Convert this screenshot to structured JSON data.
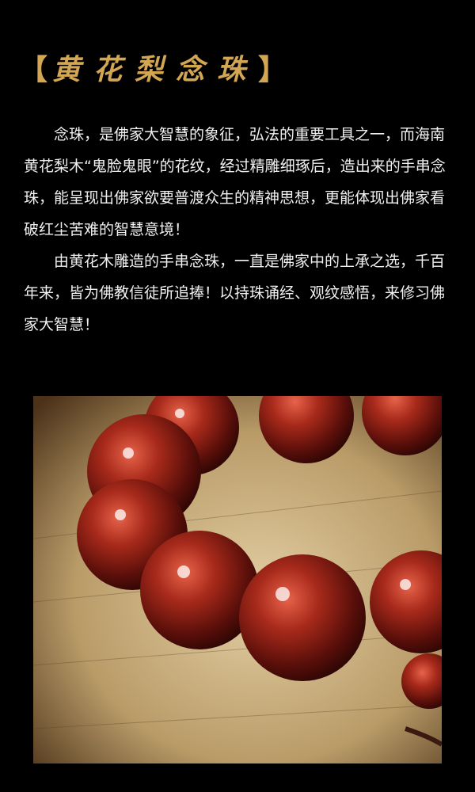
{
  "header": {
    "left_bracket": "【",
    "title": "黄花梨念珠",
    "right_bracket": "】"
  },
  "body": {
    "paragraph1": "念珠，是佛家大智慧的象征，弘法的重要工具之一，而海南黄花梨木“鬼脸鬼眼”的花纹，经过精雕细琢后，造出来的手串念珠，能呈现出佛家欲要普渡众生的精神思想，更能体现出佛家看破红尘苦难的智慧意境！",
    "paragraph2": "由黄花木雕造的手串念珠，一直是佛家中的上承之选，千百年来，皆为佛教信徒所追捧！以持珠诵经、观纹感悟，来修习佛家大智慧！"
  },
  "colors": {
    "background": "#000000",
    "title": "#d2a653",
    "text": "#f0f0f0",
    "bead": "#8e1d14"
  }
}
